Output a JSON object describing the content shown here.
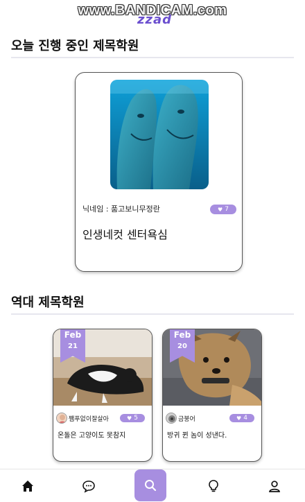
{
  "watermark": "www.BANDICAM.com",
  "logo_fragment": "zzad",
  "today": {
    "section_title": "오늘 진행 중인 제목학원",
    "photo_icon": "dolphins-photo",
    "nickname": "닉네임 : 품고보니무정란",
    "likes": "7",
    "caption": "인생네컷 센터욕심"
  },
  "history": {
    "section_title": "역대 제목학원",
    "cards": [
      {
        "month": "Feb",
        "day": "21",
        "photo_icon": "cat-lying-photo",
        "avatar_icon": "user-avatar-icon",
        "nickname": "쨈푸없이잘살아",
        "likes": "5",
        "caption": "온돌은 고양이도 못참지"
      },
      {
        "month": "Feb",
        "day": "20",
        "photo_icon": "yorkie-dog-photo",
        "avatar_icon": "user-avatar-icon",
        "nickname": "금붕어",
        "likes": "4",
        "caption": "방귀 뀐 놈이 성낸다."
      }
    ]
  },
  "nav": {
    "items": [
      "home-icon",
      "chat-icon",
      "search-icon",
      "lightbulb-icon",
      "profile-icon"
    ],
    "accent": "#a78ee0"
  },
  "colors": {
    "accent": "#a78ee0",
    "border": "#555555"
  }
}
